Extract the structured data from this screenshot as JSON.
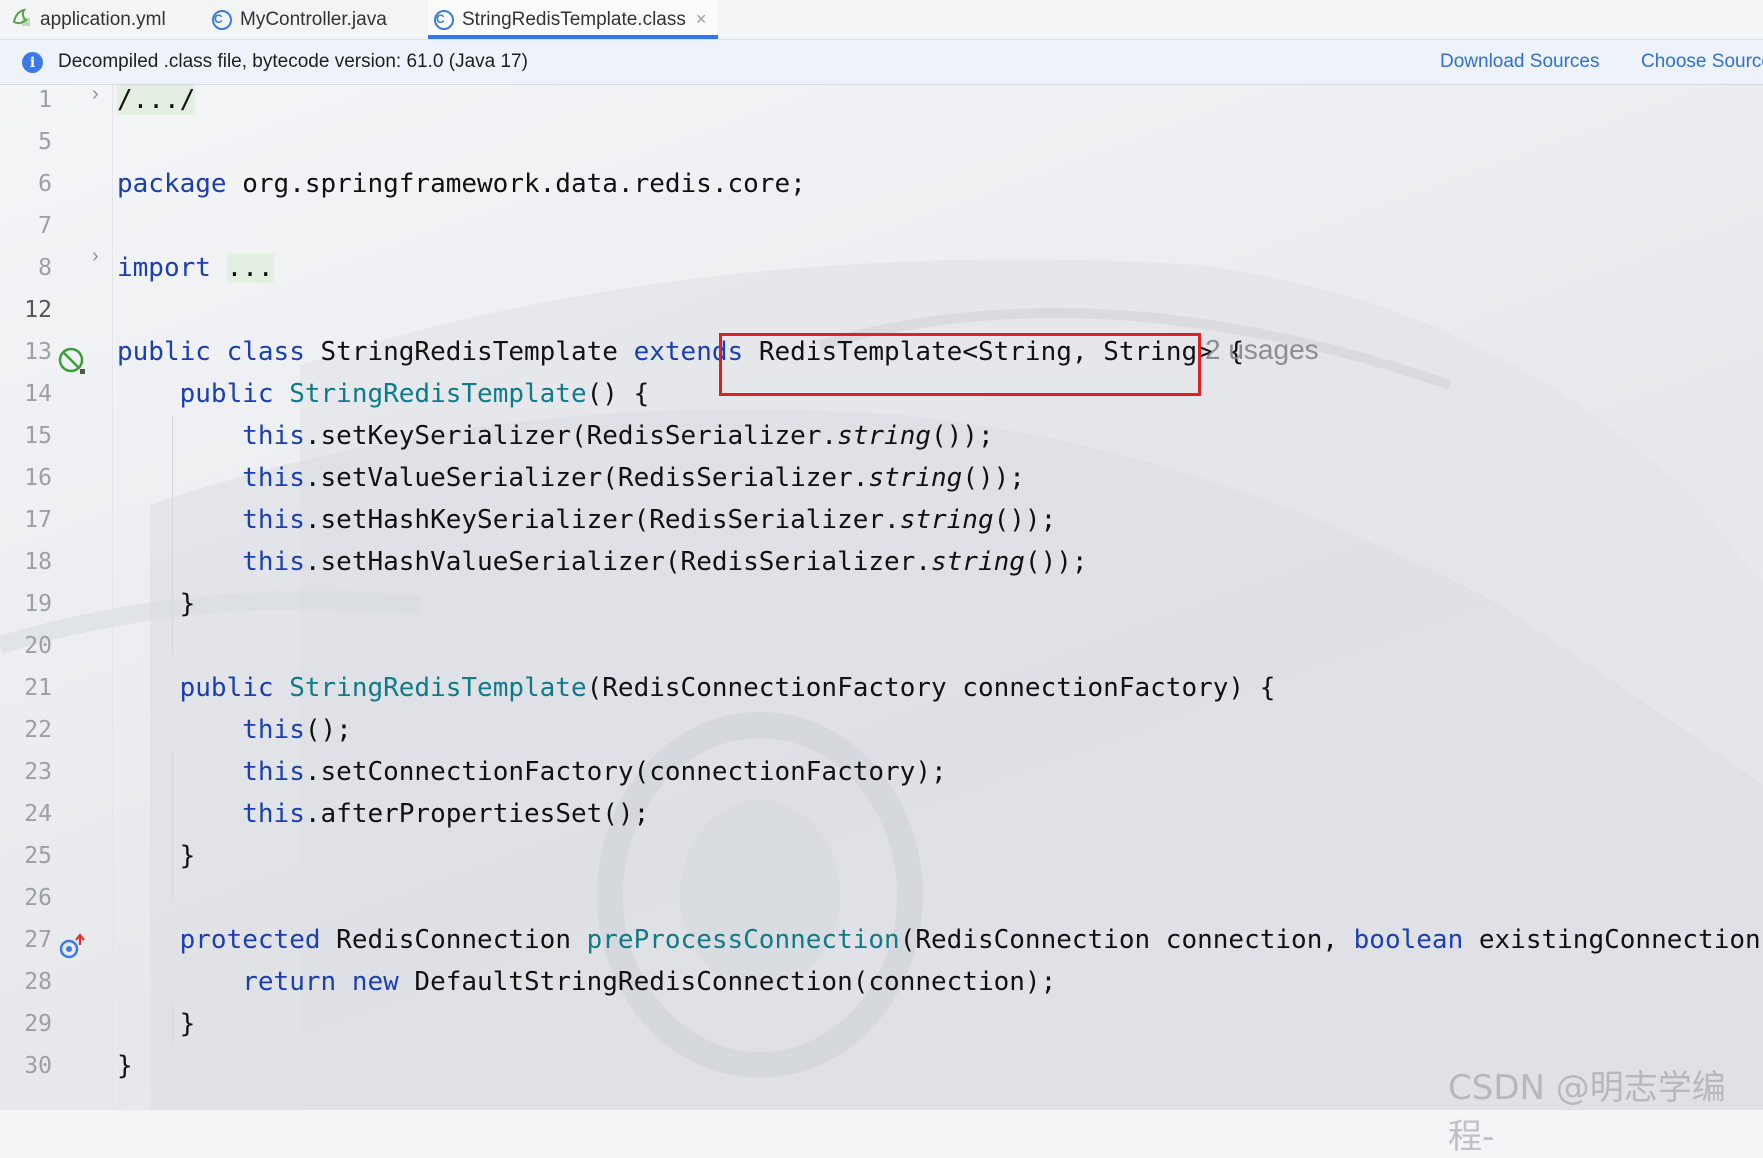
{
  "tabs": [
    {
      "label": "application.yml",
      "icon": "yaml-file-icon"
    },
    {
      "label": "MyController.java",
      "icon": "class-icon"
    },
    {
      "label": "StringRedisTemplate.class",
      "icon": "class-icon",
      "active": true,
      "close": "×"
    }
  ],
  "banner": {
    "text": "Decompiled .class file, bytecode version: 61.0 (Java 17)",
    "download_sources": "Download Sources",
    "choose_sources": "Choose Sources..."
  },
  "gutter": {
    "line_numbers": [
      "1",
      "5",
      "6",
      "7",
      "8",
      "12",
      "13",
      "14",
      "15",
      "16",
      "17",
      "18",
      "19",
      "20",
      "21",
      "22",
      "23",
      "24",
      "25",
      "26",
      "27",
      "28",
      "29",
      "30"
    ]
  },
  "code": {
    "l1": "/.../",
    "l6_kw": "package",
    "l6_rest": " org.springframework.data.redis.core;",
    "l8_kw": "import",
    "l8_rest": "...",
    "l13_kw1": "public",
    "l13_kw2": "class",
    "l13_name": "StringRedisTemplate",
    "l13_kw3": "extends",
    "l13_super": "RedisTemplate<String, String> {",
    "l13_usages": "2 usages",
    "l14_kw": "public",
    "l14_fn": "StringRedisTemplate",
    "l14_rest": "() {",
    "l15_this": "this",
    "l15_a": ".setKeySerializer(RedisSerializer.",
    "l16_this": "this",
    "l16_a": ".setValueSerializer(RedisSerializer.",
    "l17_this": "this",
    "l17_a": ".setHashKeySerializer(RedisSerializer.",
    "l18_this": "this",
    "l18_a": ".setHashValueSerializer(RedisSerializer.",
    "string_call": "string",
    "close_call": "());",
    "brace_close": "}",
    "l21_kw": "public",
    "l21_fn": "StringRedisTemplate",
    "l21_rest": "(RedisConnectionFactory connectionFactory) {",
    "l22_this": "this",
    "l22_rest": "();",
    "l23_this": "this",
    "l23_rest": ".setConnectionFactory(connectionFactory);",
    "l24_this": "this",
    "l24_rest": ".afterPropertiesSet();",
    "l27_kw": "protected",
    "l27_type": " RedisConnection ",
    "l27_fn": "preProcessConnection",
    "l27_a": "(RedisConnection connection, ",
    "l27_kw2": "boolean",
    "l27_b": " existingConnection) {",
    "l28_kw1": "return",
    "l28_kw2": "new",
    "l28_rest": " DefaultStringRedisConnection(connection);"
  },
  "watermark": "CSDN @明志学编程-"
}
